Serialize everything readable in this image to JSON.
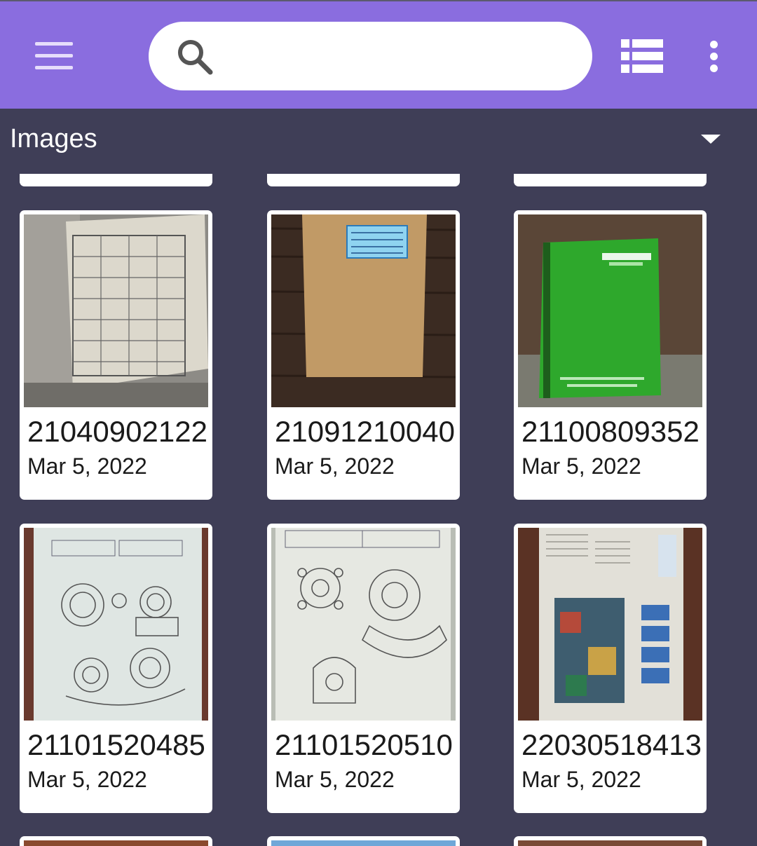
{
  "app_bar": {
    "menu_icon": "hamburger-menu-icon",
    "search": {
      "icon": "search-icon",
      "placeholder": "",
      "value": ""
    },
    "view_toggle_icon": "list-view-icon",
    "overflow_icon": "more-vert-icon"
  },
  "section": {
    "title": "Images",
    "dropdown_icon": "arrow-drop-down-icon"
  },
  "images": [
    {
      "name": "21040902122",
      "date": "Mar 5, 2022",
      "thumb": "marks-sheet-photo"
    },
    {
      "name": "21091210040",
      "date": "Mar 5, 2022",
      "thumb": "brown-notebook-photo"
    },
    {
      "name": "21100809352",
      "date": "Mar 5, 2022",
      "thumb": "green-notebook-photo"
    },
    {
      "name": "21101520485",
      "date": "Mar 5, 2022",
      "thumb": "engineering-drawing-photo"
    },
    {
      "name": "21101520510",
      "date": "Mar 5, 2022",
      "thumb": "engineering-drawing-photo"
    },
    {
      "name": "22030518413",
      "date": "Mar 5, 2022",
      "thumb": "newspaper-photo"
    }
  ],
  "colors": {
    "app_bar": "#8a6ddf",
    "background": "#3f3e57",
    "card": "#ffffff"
  }
}
